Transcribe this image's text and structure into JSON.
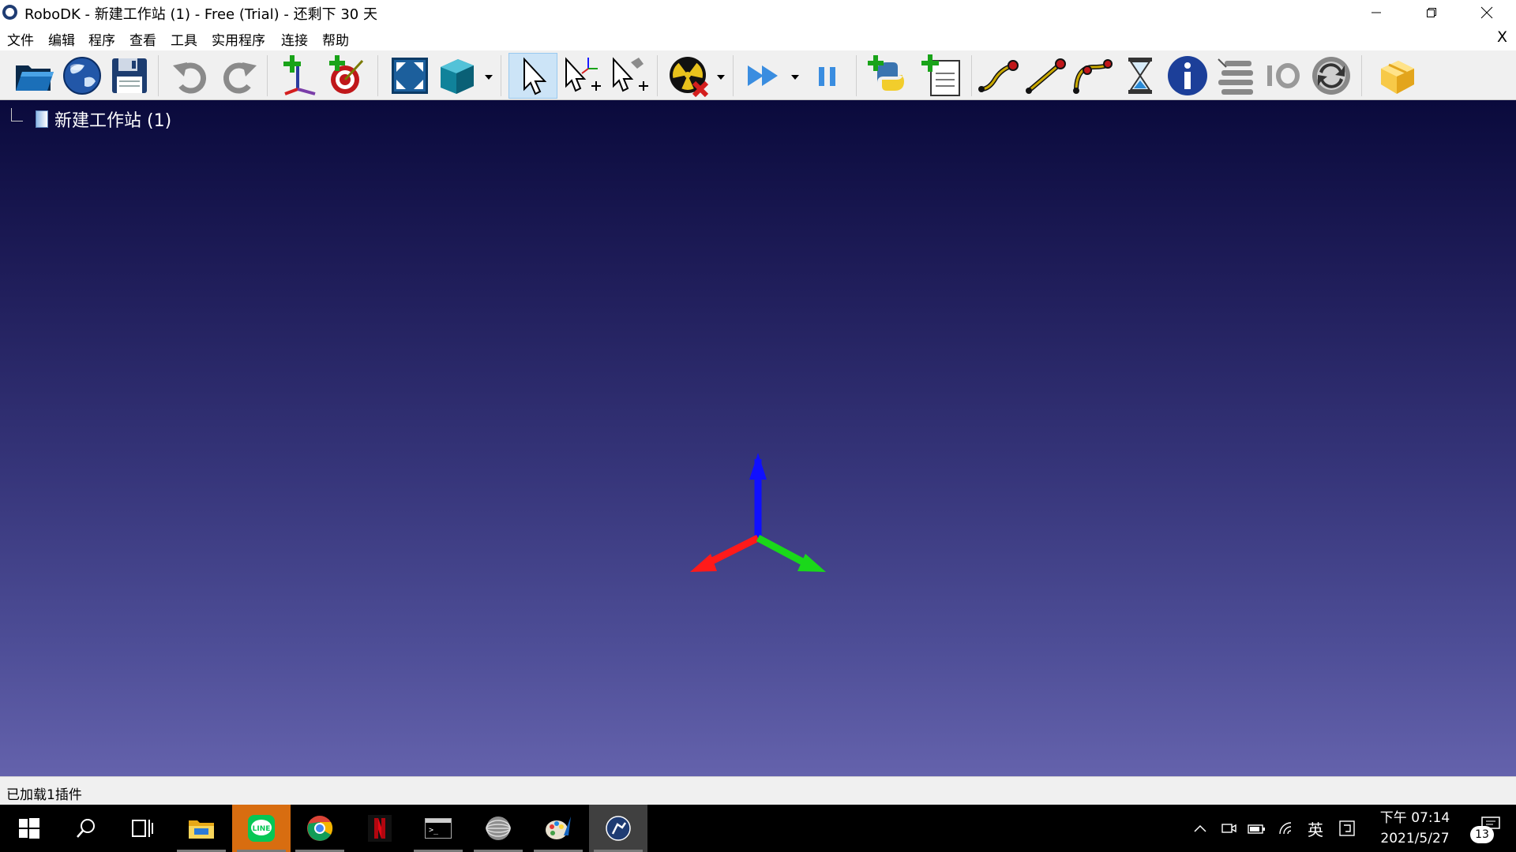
{
  "window": {
    "title": "RoboDK - 新建工作站 (1) - Free (Trial) - 还剩下 30 天"
  },
  "menu": {
    "items": [
      "文件",
      "编辑",
      "程序",
      "查看",
      "工具",
      "实用程序",
      "连接",
      "帮助"
    ],
    "close_label": "X"
  },
  "toolbar": {
    "buttons": [
      {
        "icon": "open-folder-icon"
      },
      {
        "icon": "globe-icon"
      },
      {
        "icon": "save-disk-icon"
      },
      {
        "icon": "undo-icon"
      },
      {
        "icon": "redo-icon"
      },
      {
        "icon": "add-reference-frame-icon"
      },
      {
        "icon": "add-target-icon"
      },
      {
        "icon": "fit-all-icon"
      },
      {
        "icon": "cube-view-icon"
      },
      {
        "icon": "select-pointer-icon",
        "active": true
      },
      {
        "icon": "move-reference-frame-icon"
      },
      {
        "icon": "move-tool-icon"
      },
      {
        "icon": "collision-check-icon"
      },
      {
        "icon": "fast-forward-icon"
      },
      {
        "icon": "pause-icon"
      },
      {
        "icon": "add-python-program-icon"
      },
      {
        "icon": "add-program-icon"
      },
      {
        "icon": "move-joint-instruction-icon"
      },
      {
        "icon": "move-linear-instruction-icon"
      },
      {
        "icon": "move-circular-instruction-icon"
      },
      {
        "icon": "pause-instruction-icon"
      },
      {
        "icon": "info-icon"
      },
      {
        "icon": "set-speed-icon"
      },
      {
        "icon": "io-icon"
      },
      {
        "icon": "program-call-icon"
      },
      {
        "icon": "package-icon"
      }
    ]
  },
  "tree": {
    "root_label": "新建工作站 (1)"
  },
  "viewport": {
    "background_top": "#0a0a3c",
    "background_bottom": "#6462ac",
    "axis_colors": {
      "x": "#ff1a1a",
      "y": "#1ad81a",
      "z": "#1010ff"
    }
  },
  "status": {
    "text": "已加载1插件"
  },
  "taskbar": {
    "apps": [
      "windows-start-icon",
      "search-icon",
      "task-view-icon",
      "file-explorer-icon",
      "line-app-icon",
      "chrome-icon",
      "netflix-icon",
      "terminal-icon",
      "sphere-app-icon",
      "paint-app-icon",
      "robodk-app-icon"
    ],
    "tray": {
      "input_language": "英",
      "time": "下午 07:14",
      "date": "2021/5/27",
      "notification_count": "13"
    }
  }
}
